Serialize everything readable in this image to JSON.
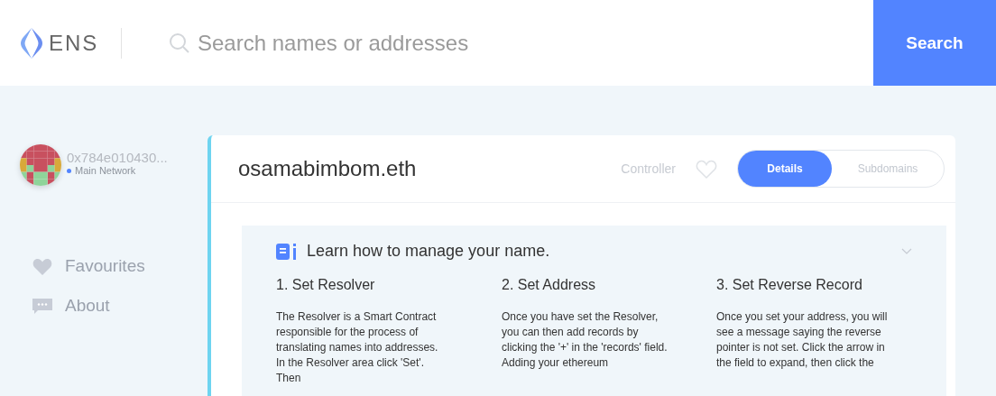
{
  "header": {
    "logo": "ENS",
    "search": {
      "placeholder": "Search names or addresses"
    },
    "search_button": "Search"
  },
  "account": {
    "address": "0x784e010430...",
    "network": "Main Network"
  },
  "nav": [
    {
      "label": "Favourites",
      "kind": "heart"
    },
    {
      "label": "About",
      "kind": "chat"
    }
  ],
  "name": {
    "title": "osamabimbom.eth",
    "controller": "Controller",
    "favourite": false,
    "tabs": [
      {
        "label": "Details",
        "selected": true
      },
      {
        "label": "Subdomains",
        "selected": false
      }
    ]
  },
  "guide": {
    "heading": "Learn how to manage your name.",
    "steps": [
      {
        "title": "1. Set Resolver",
        "text": "The Resolver is a Smart Contract responsible for the process of translating names into addresses. In the Resolver area click 'Set'. Then"
      },
      {
        "title": "2. Set Address",
        "text": "Once you have set the Resolver, you can then add records by clicking the '+' in the 'records' field. Adding your ethereum"
      },
      {
        "title": "3. Set Reverse Record",
        "text": "Once you set your address, you will see a message saying the reverse pointer is not set. Click the arrow in the field to expand, then click the"
      }
    ]
  }
}
